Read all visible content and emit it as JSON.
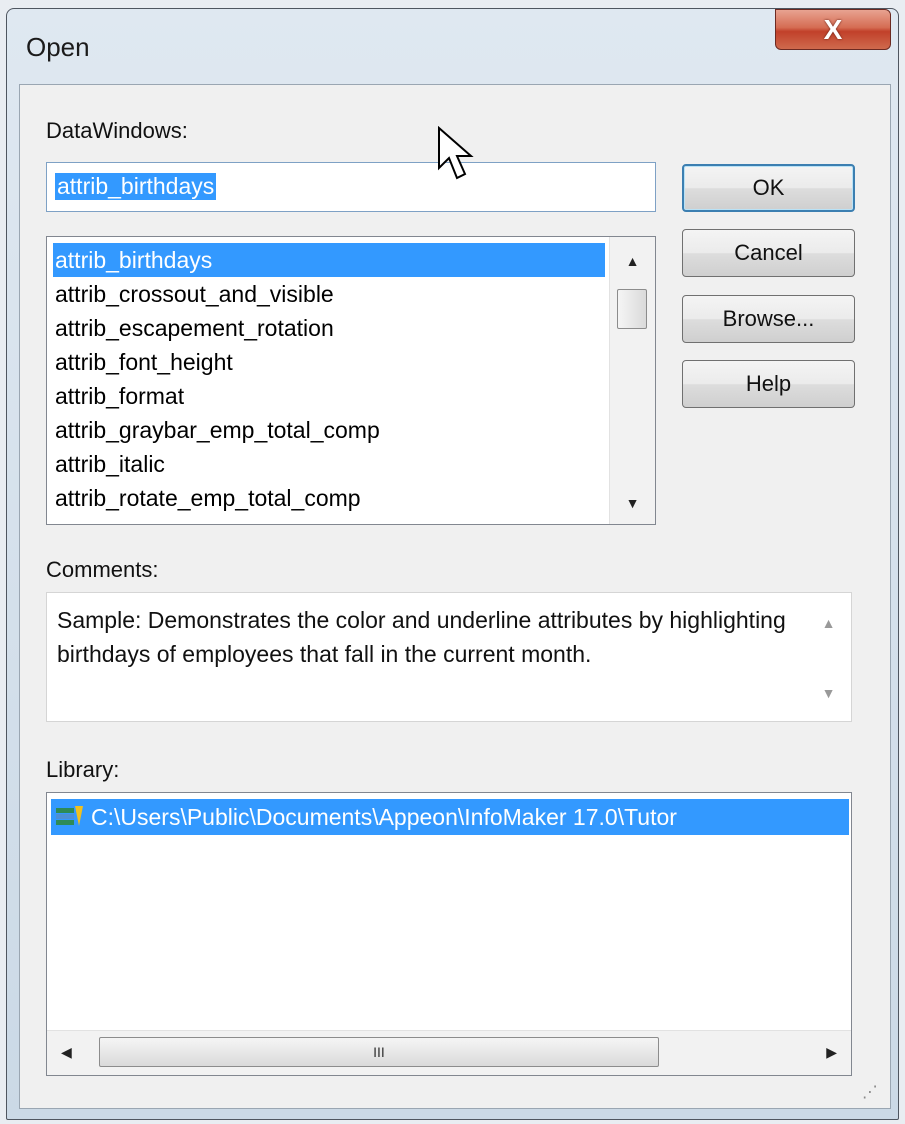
{
  "window": {
    "title": "Open",
    "close_label": "X"
  },
  "datawindows": {
    "label": "DataWindows:",
    "input_value": "attrib_birthdays",
    "items": [
      "attrib_birthdays",
      "attrib_crossout_and_visible",
      "attrib_escapement_rotation",
      "attrib_font_height",
      "attrib_format",
      "attrib_graybar_emp_total_comp",
      "attrib_italic",
      "attrib_rotate_emp_total_comp"
    ],
    "selected_index": 0
  },
  "buttons": {
    "ok": "OK",
    "cancel": "Cancel",
    "browse": "Browse...",
    "help": "Help"
  },
  "comments": {
    "label": "Comments:",
    "text": "Sample: Demonstrates the color and underline attributes by highlighting birthdays of employees that fall in the current month."
  },
  "library": {
    "label": "Library:",
    "items": [
      "C:\\Users\\Public\\Documents\\Appeon\\InfoMaker 17.0\\Tutor"
    ],
    "scroll_grip": "III"
  },
  "icons": {
    "library_icon": "library-icon",
    "mouse_pointer": "mouse-pointer-icon"
  },
  "colors": {
    "selection": "#3399ff",
    "close_button": "#c1402a"
  }
}
